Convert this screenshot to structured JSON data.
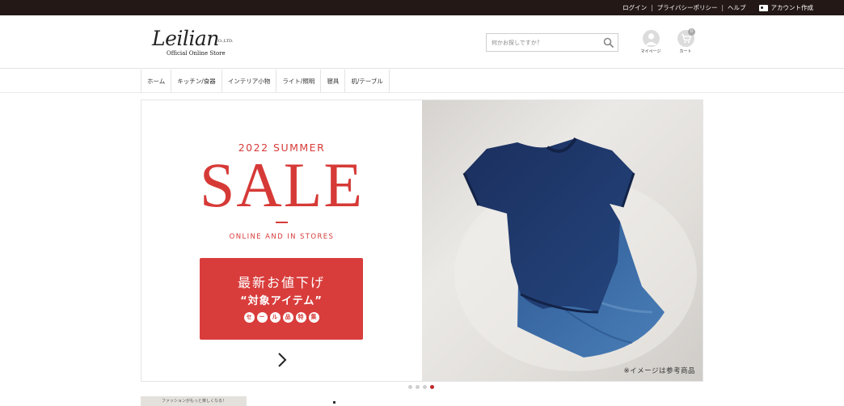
{
  "topbar": {
    "login": "ログイン",
    "privacy": "プライバシーポリシー",
    "help": "ヘルプ",
    "create_account": "アカウント作成",
    "separator": "|"
  },
  "header": {
    "logo_main": "Leilian",
    "logo_co": "CO.,LTD.",
    "logo_sub": "Official Online Store",
    "search_placeholder": "何かお探しですか？",
    "mypage_label": "マイページ",
    "cart_label": "カート",
    "cart_count": "0"
  },
  "nav": {
    "items": [
      "ホーム",
      "キッチン/食器",
      "インテリア小物",
      "ライト/照明",
      "寝具",
      "机/テーブル"
    ]
  },
  "banner": {
    "season": "2022 SUMMER",
    "headline": "SALE",
    "subline": "ONLINE AND IN STORES",
    "cta_line1": "最新お値下げ",
    "cta_line2": "“対象アイテム”",
    "cta_chips": [
      "セ",
      "ー",
      "ル",
      "品",
      "特",
      "集"
    ],
    "image_note": "※イメージは参考商品",
    "accent_color": "#d63a37",
    "product_color": "#1f3a6b"
  },
  "carousel": {
    "total_slides": 4,
    "active_slide": 4
  },
  "promo": {
    "text": "ファッションがもっと楽しくなる！"
  }
}
